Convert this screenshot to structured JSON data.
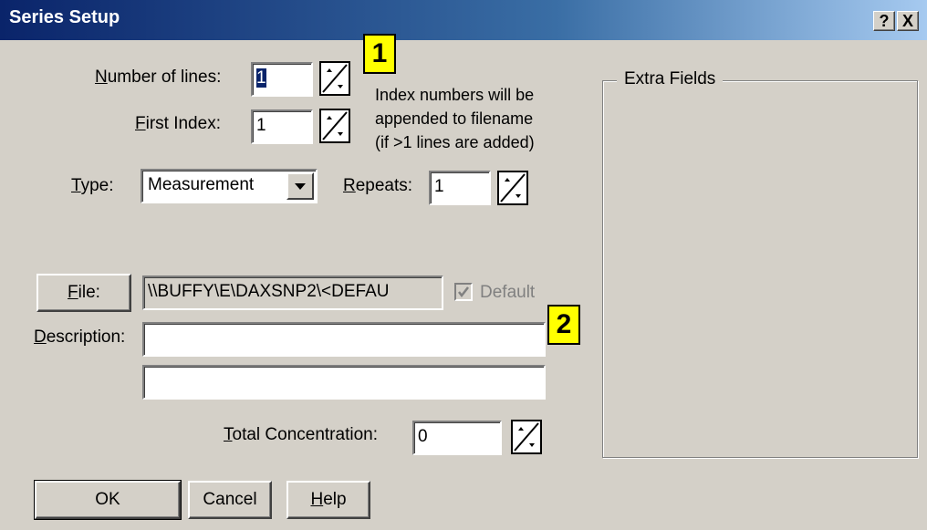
{
  "window": {
    "title": "Series Setup",
    "help_button": "?",
    "close_button": "X"
  },
  "form": {
    "number_of_lines_label_underlined": "N",
    "number_of_lines_label_rest": "umber of lines:",
    "number_of_lines_value": "1",
    "first_index_label_underlined": "F",
    "first_index_label_rest": "irst Index:",
    "first_index_value": "1",
    "index_note_line1": "Index numbers will be",
    "index_note_line2": "appended to filename",
    "index_note_line3": "(if >1 lines are added)",
    "type_label_underlined": "T",
    "type_label_rest": "ype:",
    "type_value": "Measurement",
    "repeats_label_underlined": "R",
    "repeats_label_rest": "epeats:",
    "repeats_value": "1",
    "file_button_underlined": "F",
    "file_button_rest": "ile:",
    "file_value": "\\\\BUFFY\\E\\DAXSNP2\\<DEFAU",
    "default_checkbox_label": "Default",
    "description_label_underlined": "D",
    "description_label_rest": "escription:",
    "description_line1": "",
    "description_line2": "",
    "total_concentration_label_underlined": "T",
    "total_concentration_label_rest": "otal Concentration:",
    "total_concentration_value": "0"
  },
  "extra_fields": {
    "title": "Extra Fields"
  },
  "buttons": {
    "ok": "OK",
    "cancel": "Cancel",
    "help_underlined": "H",
    "help_rest": "elp"
  },
  "badges": {
    "badge1": "1",
    "badge2": "2"
  }
}
